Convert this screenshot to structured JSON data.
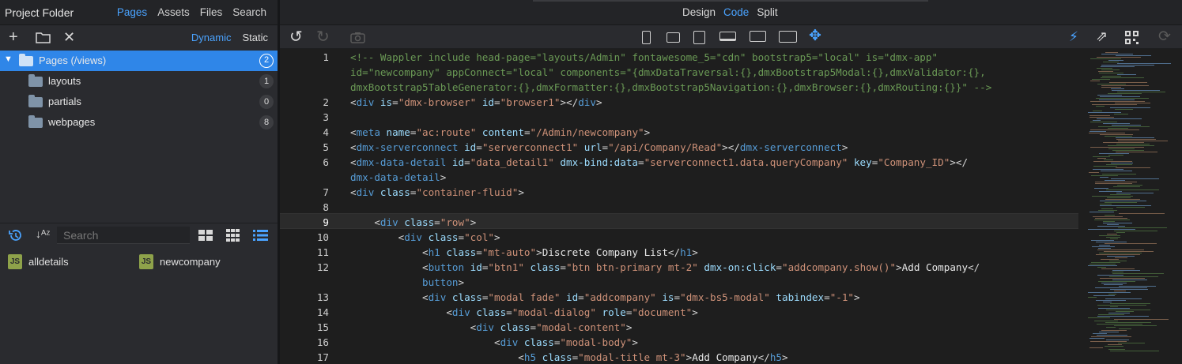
{
  "left": {
    "title": "Project Folder",
    "tabs": [
      "Pages",
      "Assets",
      "Files",
      "Search"
    ],
    "active_tab": "Pages",
    "toolbar": {
      "modes": [
        "Dynamic",
        "Static"
      ],
      "active_mode": "Dynamic"
    },
    "tree": [
      {
        "label": "Pages (/views)",
        "count": "2",
        "selected": true
      },
      {
        "label": "layouts",
        "count": "1"
      },
      {
        "label": "partials",
        "count": "0"
      },
      {
        "label": "webpages",
        "count": "8"
      }
    ],
    "files_bar": {
      "search_placeholder": "Search"
    },
    "files": [
      {
        "icon": "JS",
        "name": "alldetails"
      },
      {
        "icon": "JS",
        "name": "newcompany"
      }
    ]
  },
  "right": {
    "modes": [
      "Design",
      "Code",
      "Split"
    ],
    "active_mode": "Code",
    "current_line": "9"
  },
  "code": [
    {
      "n": "1",
      "parts": [
        [
          "cm",
          "<!-- Wappler include head-page=\"layouts/Admin\" fontawesome_5=\"cdn\" bootstrap5=\"local\" is=\"dmx-app\""
        ]
      ]
    },
    {
      "n": "",
      "parts": [
        [
          "cm",
          "id=\"newcompany\" appConnect=\"local\" components=\"{dmxDataTraversal:{},dmxBootstrap5Modal:{},dmxValidator:{},"
        ]
      ]
    },
    {
      "n": "",
      "parts": [
        [
          "cm",
          "dmxBootstrap5TableGenerator:{},dmxFormatter:{},dmxBootstrap5Navigation:{},dmxBrowser:{},dmxRouting:{}}\" -->"
        ]
      ]
    },
    {
      "n": "2",
      "parts": [
        [
          "t",
          "<"
        ],
        [
          "tg",
          "div"
        ],
        [
          "at",
          " is"
        ],
        [
          "t",
          "="
        ],
        [
          "st",
          "\"dmx-browser\""
        ],
        [
          "at",
          " id"
        ],
        [
          "t",
          "="
        ],
        [
          "st",
          "\"browser1\""
        ],
        [
          "t",
          "></"
        ],
        [
          "tg",
          "div"
        ],
        [
          "t",
          ">"
        ]
      ]
    },
    {
      "n": "3",
      "parts": []
    },
    {
      "n": "4",
      "parts": [
        [
          "t",
          "<"
        ],
        [
          "tg",
          "meta"
        ],
        [
          "at",
          " name"
        ],
        [
          "t",
          "="
        ],
        [
          "st",
          "\"ac:route\""
        ],
        [
          "at",
          " content"
        ],
        [
          "t",
          "="
        ],
        [
          "st",
          "\"/Admin/newcompany\""
        ],
        [
          "t",
          ">"
        ]
      ]
    },
    {
      "n": "5",
      "parts": [
        [
          "t",
          "<"
        ],
        [
          "tg",
          "dmx-serverconnect"
        ],
        [
          "at",
          " id"
        ],
        [
          "t",
          "="
        ],
        [
          "st",
          "\"serverconnect1\""
        ],
        [
          "at",
          " url"
        ],
        [
          "t",
          "="
        ],
        [
          "st",
          "\"/api/Company/Read\""
        ],
        [
          "t",
          "></"
        ],
        [
          "tg",
          "dmx-serverconnect"
        ],
        [
          "t",
          ">"
        ]
      ]
    },
    {
      "n": "6",
      "parts": [
        [
          "t",
          "<"
        ],
        [
          "tg",
          "dmx-data-detail"
        ],
        [
          "at",
          " id"
        ],
        [
          "t",
          "="
        ],
        [
          "st",
          "\"data_detail1\""
        ],
        [
          "at",
          " dmx-bind:data"
        ],
        [
          "t",
          "="
        ],
        [
          "st",
          "\"serverconnect1.data.queryCompany\""
        ],
        [
          "at",
          " key"
        ],
        [
          "t",
          "="
        ],
        [
          "st",
          "\"Company_ID\""
        ],
        [
          "t",
          "></"
        ]
      ]
    },
    {
      "n": "",
      "parts": [
        [
          "tg",
          "dmx-data-detail"
        ],
        [
          "t",
          ">"
        ]
      ]
    },
    {
      "n": "7",
      "parts": [
        [
          "t",
          "<"
        ],
        [
          "tg",
          "div"
        ],
        [
          "at",
          " class"
        ],
        [
          "t",
          "="
        ],
        [
          "st",
          "\"container-fluid\""
        ],
        [
          "t",
          ">"
        ]
      ]
    },
    {
      "n": "8",
      "parts": []
    },
    {
      "n": "9",
      "parts": [
        [
          "t",
          "    <"
        ],
        [
          "tg",
          "div"
        ],
        [
          "at",
          " class"
        ],
        [
          "t",
          "="
        ],
        [
          "st",
          "\"row\""
        ],
        [
          "t",
          ">"
        ]
      ]
    },
    {
      "n": "10",
      "parts": [
        [
          "t",
          "        <"
        ],
        [
          "tg",
          "div"
        ],
        [
          "at",
          " class"
        ],
        [
          "t",
          "="
        ],
        [
          "st",
          "\"col\""
        ],
        [
          "t",
          ">"
        ]
      ]
    },
    {
      "n": "11",
      "parts": [
        [
          "t",
          "            <"
        ],
        [
          "tg",
          "h1"
        ],
        [
          "at",
          " class"
        ],
        [
          "t",
          "="
        ],
        [
          "st",
          "\"mt-auto\""
        ],
        [
          "t",
          ">"
        ],
        [
          "tx",
          "Discrete Company List"
        ],
        [
          "t",
          "</"
        ],
        [
          "tg",
          "h1"
        ],
        [
          "t",
          ">"
        ]
      ]
    },
    {
      "n": "12",
      "parts": [
        [
          "t",
          "            <"
        ],
        [
          "tg",
          "button"
        ],
        [
          "at",
          " id"
        ],
        [
          "t",
          "="
        ],
        [
          "st",
          "\"btn1\""
        ],
        [
          "at",
          " class"
        ],
        [
          "t",
          "="
        ],
        [
          "st",
          "\"btn btn-primary mt-2\""
        ],
        [
          "at",
          " dmx-on:click"
        ],
        [
          "t",
          "="
        ],
        [
          "st",
          "\"addcompany.show()\""
        ],
        [
          "t",
          ">"
        ],
        [
          "tx",
          "Add Company"
        ],
        [
          "t",
          "</"
        ]
      ]
    },
    {
      "n": "",
      "parts": [
        [
          "t",
          "            "
        ],
        [
          "tg",
          "button"
        ],
        [
          "t",
          ">"
        ]
      ]
    },
    {
      "n": "13",
      "parts": [
        [
          "t",
          "            <"
        ],
        [
          "tg",
          "div"
        ],
        [
          "at",
          " class"
        ],
        [
          "t",
          "="
        ],
        [
          "st",
          "\"modal fade\""
        ],
        [
          "at",
          " id"
        ],
        [
          "t",
          "="
        ],
        [
          "st",
          "\"addcompany\""
        ],
        [
          "at",
          " is"
        ],
        [
          "t",
          "="
        ],
        [
          "st",
          "\"dmx-bs5-modal\""
        ],
        [
          "at",
          " tabindex"
        ],
        [
          "t",
          "="
        ],
        [
          "st",
          "\"-1\""
        ],
        [
          "t",
          ">"
        ]
      ]
    },
    {
      "n": "14",
      "parts": [
        [
          "t",
          "                <"
        ],
        [
          "tg",
          "div"
        ],
        [
          "at",
          " class"
        ],
        [
          "t",
          "="
        ],
        [
          "st",
          "\"modal-dialog\""
        ],
        [
          "at",
          " role"
        ],
        [
          "t",
          "="
        ],
        [
          "st",
          "\"document\""
        ],
        [
          "t",
          ">"
        ]
      ]
    },
    {
      "n": "15",
      "parts": [
        [
          "t",
          "                    <"
        ],
        [
          "tg",
          "div"
        ],
        [
          "at",
          " class"
        ],
        [
          "t",
          "="
        ],
        [
          "st",
          "\"modal-content\""
        ],
        [
          "t",
          ">"
        ]
      ]
    },
    {
      "n": "16",
      "parts": [
        [
          "t",
          "                        <"
        ],
        [
          "tg",
          "div"
        ],
        [
          "at",
          " class"
        ],
        [
          "t",
          "="
        ],
        [
          "st",
          "\"modal-body\""
        ],
        [
          "t",
          ">"
        ]
      ]
    },
    {
      "n": "17",
      "parts": [
        [
          "t",
          "                            <"
        ],
        [
          "tg",
          "h5"
        ],
        [
          "at",
          " class"
        ],
        [
          "t",
          "="
        ],
        [
          "st",
          "\"modal-title mt-3\""
        ],
        [
          "t",
          ">"
        ],
        [
          "tx",
          "Add Company"
        ],
        [
          "t",
          "</"
        ],
        [
          "tg",
          "h5"
        ],
        [
          "t",
          ">"
        ]
      ]
    }
  ]
}
